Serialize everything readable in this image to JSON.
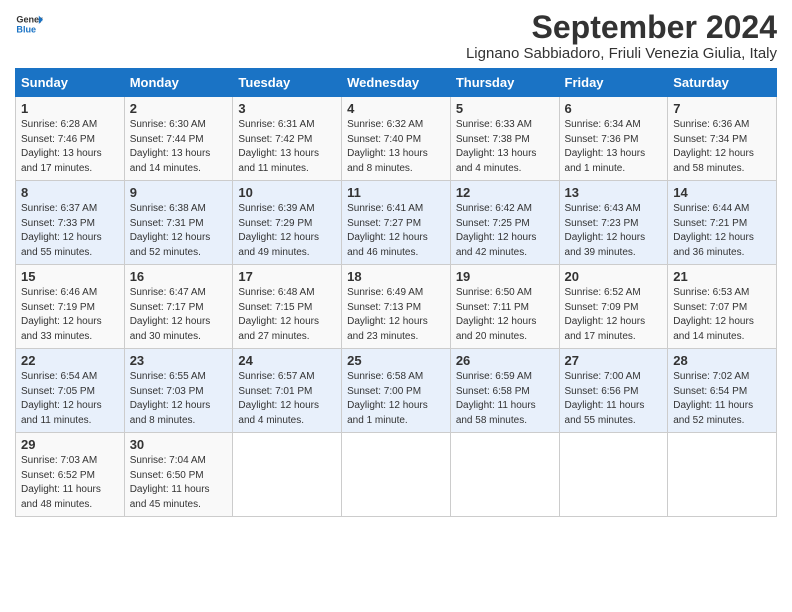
{
  "logo": {
    "line1": "General",
    "line2": "Blue"
  },
  "title": "September 2024",
  "subtitle": "Lignano Sabbiadoro, Friuli Venezia Giulia, Italy",
  "days_of_week": [
    "Sunday",
    "Monday",
    "Tuesday",
    "Wednesday",
    "Thursday",
    "Friday",
    "Saturday"
  ],
  "weeks": [
    [
      {
        "day": 1,
        "sunrise": "6:28 AM",
        "sunset": "7:46 PM",
        "daylight": "13 hours and 17 minutes."
      },
      {
        "day": 2,
        "sunrise": "6:30 AM",
        "sunset": "7:44 PM",
        "daylight": "13 hours and 14 minutes."
      },
      {
        "day": 3,
        "sunrise": "6:31 AM",
        "sunset": "7:42 PM",
        "daylight": "13 hours and 11 minutes."
      },
      {
        "day": 4,
        "sunrise": "6:32 AM",
        "sunset": "7:40 PM",
        "daylight": "13 hours and 8 minutes."
      },
      {
        "day": 5,
        "sunrise": "6:33 AM",
        "sunset": "7:38 PM",
        "daylight": "13 hours and 4 minutes."
      },
      {
        "day": 6,
        "sunrise": "6:34 AM",
        "sunset": "7:36 PM",
        "daylight": "13 hours and 1 minute."
      },
      {
        "day": 7,
        "sunrise": "6:36 AM",
        "sunset": "7:34 PM",
        "daylight": "12 hours and 58 minutes."
      }
    ],
    [
      {
        "day": 8,
        "sunrise": "6:37 AM",
        "sunset": "7:33 PM",
        "daylight": "12 hours and 55 minutes."
      },
      {
        "day": 9,
        "sunrise": "6:38 AM",
        "sunset": "7:31 PM",
        "daylight": "12 hours and 52 minutes."
      },
      {
        "day": 10,
        "sunrise": "6:39 AM",
        "sunset": "7:29 PM",
        "daylight": "12 hours and 49 minutes."
      },
      {
        "day": 11,
        "sunrise": "6:41 AM",
        "sunset": "7:27 PM",
        "daylight": "12 hours and 46 minutes."
      },
      {
        "day": 12,
        "sunrise": "6:42 AM",
        "sunset": "7:25 PM",
        "daylight": "12 hours and 42 minutes."
      },
      {
        "day": 13,
        "sunrise": "6:43 AM",
        "sunset": "7:23 PM",
        "daylight": "12 hours and 39 minutes."
      },
      {
        "day": 14,
        "sunrise": "6:44 AM",
        "sunset": "7:21 PM",
        "daylight": "12 hours and 36 minutes."
      }
    ],
    [
      {
        "day": 15,
        "sunrise": "6:46 AM",
        "sunset": "7:19 PM",
        "daylight": "12 hours and 33 minutes."
      },
      {
        "day": 16,
        "sunrise": "6:47 AM",
        "sunset": "7:17 PM",
        "daylight": "12 hours and 30 minutes."
      },
      {
        "day": 17,
        "sunrise": "6:48 AM",
        "sunset": "7:15 PM",
        "daylight": "12 hours and 27 minutes."
      },
      {
        "day": 18,
        "sunrise": "6:49 AM",
        "sunset": "7:13 PM",
        "daylight": "12 hours and 23 minutes."
      },
      {
        "day": 19,
        "sunrise": "6:50 AM",
        "sunset": "7:11 PM",
        "daylight": "12 hours and 20 minutes."
      },
      {
        "day": 20,
        "sunrise": "6:52 AM",
        "sunset": "7:09 PM",
        "daylight": "12 hours and 17 minutes."
      },
      {
        "day": 21,
        "sunrise": "6:53 AM",
        "sunset": "7:07 PM",
        "daylight": "12 hours and 14 minutes."
      }
    ],
    [
      {
        "day": 22,
        "sunrise": "6:54 AM",
        "sunset": "7:05 PM",
        "daylight": "12 hours and 11 minutes."
      },
      {
        "day": 23,
        "sunrise": "6:55 AM",
        "sunset": "7:03 PM",
        "daylight": "12 hours and 8 minutes."
      },
      {
        "day": 24,
        "sunrise": "6:57 AM",
        "sunset": "7:01 PM",
        "daylight": "12 hours and 4 minutes."
      },
      {
        "day": 25,
        "sunrise": "6:58 AM",
        "sunset": "7:00 PM",
        "daylight": "12 hours and 1 minute."
      },
      {
        "day": 26,
        "sunrise": "6:59 AM",
        "sunset": "6:58 PM",
        "daylight": "11 hours and 58 minutes."
      },
      {
        "day": 27,
        "sunrise": "7:00 AM",
        "sunset": "6:56 PM",
        "daylight": "11 hours and 55 minutes."
      },
      {
        "day": 28,
        "sunrise": "7:02 AM",
        "sunset": "6:54 PM",
        "daylight": "11 hours and 52 minutes."
      }
    ],
    [
      {
        "day": 29,
        "sunrise": "7:03 AM",
        "sunset": "6:52 PM",
        "daylight": "11 hours and 48 minutes."
      },
      {
        "day": 30,
        "sunrise": "7:04 AM",
        "sunset": "6:50 PM",
        "daylight": "11 hours and 45 minutes."
      },
      null,
      null,
      null,
      null,
      null
    ]
  ]
}
